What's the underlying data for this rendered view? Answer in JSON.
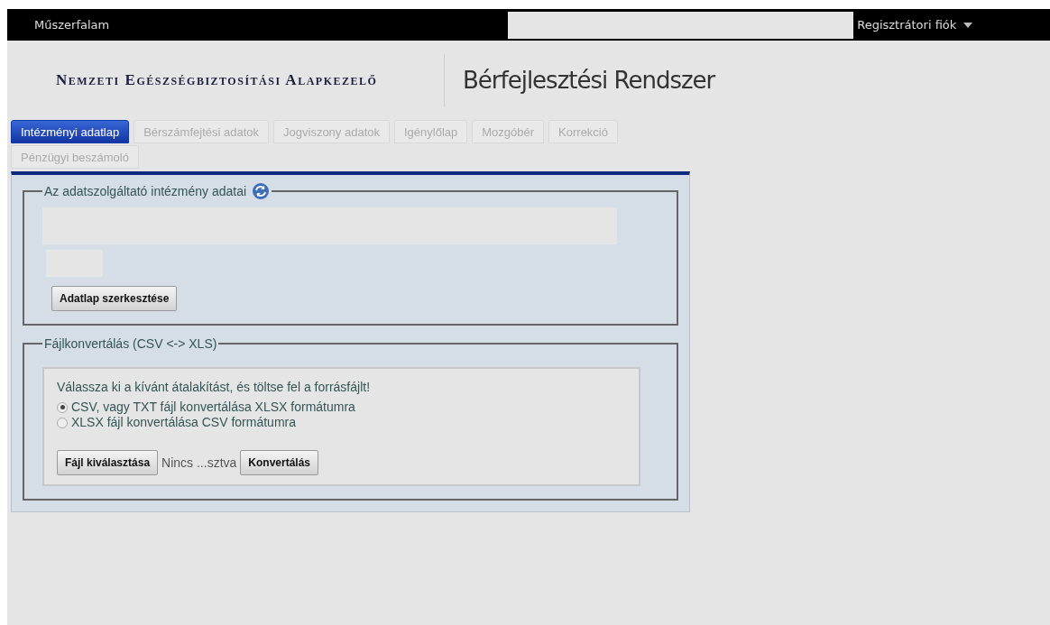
{
  "top_bar": {
    "home_link": "Műszerfalam",
    "account_menu": "Regisztrátori fiók"
  },
  "header": {
    "organization": "Nemzeti Egészségbiztosítási Alapkezelő",
    "system_title": "Bérfejlesztési Rendszer"
  },
  "tabs": [
    {
      "label": "Intézményi adatlap",
      "selected": true
    },
    {
      "label": "Bérszámfejtési adatok",
      "selected": false
    },
    {
      "label": "Jogviszony adatok",
      "selected": false
    },
    {
      "label": "Igénylőlap",
      "selected": false
    },
    {
      "label": "Mozgóbér",
      "selected": false
    },
    {
      "label": "Korrekció",
      "selected": false
    },
    {
      "label": "Pénzügyi beszámoló",
      "selected": false
    }
  ],
  "institution_section": {
    "legend": "Az adatszolgáltató intézmény adatai",
    "edit_button": "Adatlap szerkesztése"
  },
  "conversion_section": {
    "legend": "Fájlkonvertálás (CSV <-> XLS)",
    "instruction": "Válassza ki a kívánt átalakítást, és töltse fel a forrásfájlt!",
    "options": [
      {
        "label": "CSV, vagy TXT fájl konvertálása XLSX formátumra",
        "selected": true
      },
      {
        "label": "XLSX fájl konvertálása CSV formátumra",
        "selected": false
      }
    ],
    "choose_file_button": "Fájl kiválasztása",
    "file_status": "Nincs ...sztva",
    "convert_button": "Konvertálás"
  }
}
